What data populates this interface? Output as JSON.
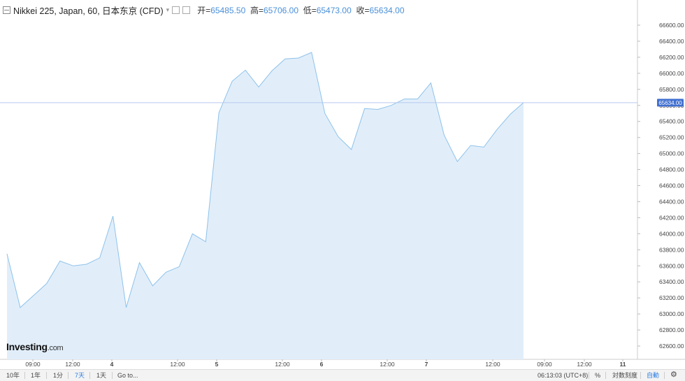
{
  "header": {
    "title": "Nikkei 225, Japan, 60, 日本东京 (CFD)",
    "open_label": "开=",
    "open_value": "65485.50",
    "high_label": "高=",
    "high_value": "65706.00",
    "low_label": "低=",
    "low_value": "65473.00",
    "close_label": "收=",
    "close_value": "65634.00"
  },
  "logo": {
    "brand": "Investing",
    "suffix": ".com"
  },
  "footer": {
    "range_buttons": [
      "10年",
      "1年",
      "1分",
      "7天",
      "1天"
    ],
    "goto": "Go to...",
    "time": "06:13:03 (UTC+8)",
    "percent": "%",
    "log_scale": "対数刻度",
    "auto": "自動"
  },
  "colors": {
    "line": "#8ec2ea",
    "fill": "#e1eefa",
    "price_tag": "#3f6fd0",
    "accent": "#2a7de1"
  },
  "chart_data": {
    "type": "area",
    "ylim": [
      62500,
      66700
    ],
    "y_ticks": [
      62600,
      62800,
      63000,
      63200,
      63400,
      63600,
      63800,
      64000,
      64200,
      64400,
      64600,
      64800,
      65000,
      65200,
      65400,
      65600,
      65800,
      66000,
      66200,
      66400,
      66600
    ],
    "y_tick_labels": [
      "62600.00",
      "62800.00",
      "63000.00",
      "63200.00",
      "63400.00",
      "63600.00",
      "63800.00",
      "64000.00",
      "64200.00",
      "64400.00",
      "64600.00",
      "64800.00",
      "65000.00",
      "65200.00",
      "65400.00",
      "65600.00",
      "65800.00",
      "66000.00",
      "66200.00",
      "66400.00",
      "66600.00"
    ],
    "x_tick_labels": [
      "09:00",
      "12:00",
      "4",
      "12:00",
      "5",
      "12:00",
      "6",
      "12:00",
      "7",
      "12:00",
      "09:00",
      "12:00",
      "11"
    ],
    "last_price": "65634.00",
    "values": [
      63750,
      63080,
      63230,
      63380,
      63660,
      63600,
      63620,
      63700,
      64220,
      63080,
      63640,
      63350,
      63520,
      63590,
      64000,
      63900,
      65510,
      65900,
      66040,
      65830,
      66030,
      66180,
      66190,
      66260,
      65500,
      65210,
      65050,
      65560,
      65550,
      65600,
      65680,
      65680,
      65880,
      65230,
      64900,
      65100,
      65080,
      65300,
      65490,
      65634
    ]
  }
}
